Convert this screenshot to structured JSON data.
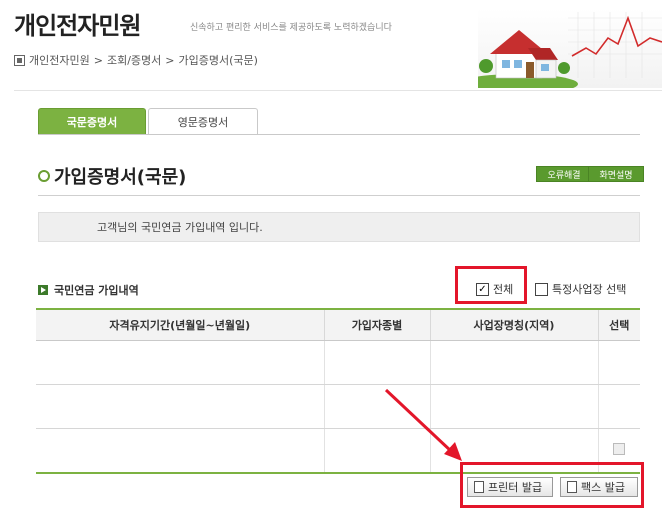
{
  "header": {
    "site_title": "개인전자민원",
    "slogan": "신속하고 편리한 서비스를 제공하도록 노력하겠습니다"
  },
  "breadcrumb": [
    "개인전자민원",
    "조회/증명서",
    "가입증명서(국문)"
  ],
  "tabs": [
    {
      "label": "국문증명서",
      "active": true
    },
    {
      "label": "영문증명서",
      "active": false
    }
  ],
  "page": {
    "title": "가입증명서(국문)",
    "error_report": "오류해결",
    "screen_help": "화면설명",
    "info_text": "고객님의 국민연금 가입내역 입니다."
  },
  "list": {
    "heading": "국민연금 가입내역",
    "check_all_label": "전체",
    "check_all_checked": true,
    "check_site_label": "특정사업장 선택",
    "columns": [
      "자격유지기간(년월일~년월일)",
      "가입자종별",
      "사업장명칭(지역)",
      "선택"
    ],
    "rows": [
      [
        "",
        "",
        "",
        ""
      ],
      [
        "",
        "",
        "",
        ""
      ],
      [
        "",
        "",
        "",
        ""
      ]
    ]
  },
  "actions": {
    "print_label": "프린터 발급",
    "fax_label": "팩스 발급"
  },
  "colors": {
    "accent_green": "#7cb241",
    "highlight_red": "#e3162a"
  },
  "icons": [
    "home-icon",
    "circle-icon",
    "arrow-icon",
    "printer-icon",
    "fax-icon"
  ]
}
